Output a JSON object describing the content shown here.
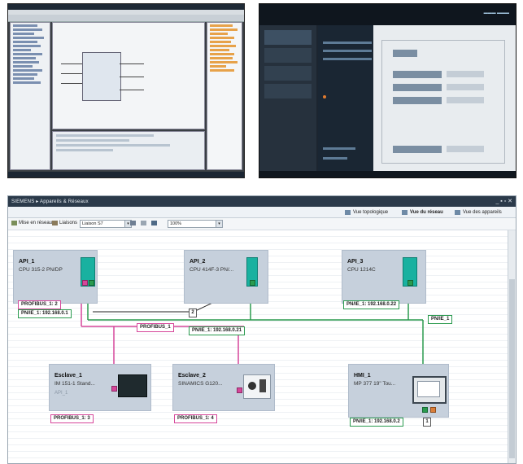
{
  "window": {
    "title": "SIEMENS  ▸  Appareils & Réseaux",
    "controls": "_ ▪ ▫ ✕"
  },
  "view_tabs": [
    {
      "label": "Vue topologique",
      "active": false
    },
    {
      "label": "Vue du réseau",
      "active": true
    },
    {
      "label": "Vue des appareils",
      "active": false
    }
  ],
  "toolbar": {
    "network_button": "Mise en réseau",
    "connections_button": "Liaisons",
    "connection_type": "Liaison S7",
    "zoom": "100%"
  },
  "devices": {
    "plc1": {
      "name": "API_1",
      "type": "CPU 315-2 PN/DP"
    },
    "plc2": {
      "name": "API_2",
      "type": "CPU 414F-3 PN/..."
    },
    "plc3": {
      "name": "API_3",
      "type": "CPU 1214C"
    },
    "slave1": {
      "name": "Esclave_1",
      "type": "IM 151-1 Stand...",
      "sub": "API_1"
    },
    "slave2": {
      "name": "Esclave_2",
      "type": "SINAMICS G120..."
    },
    "hmi1": {
      "name": "HMI_1",
      "type": "MP 377 19\" Tou..."
    }
  },
  "addresses": {
    "plc1_profibus": "PROFIBUS_1: 2",
    "plc1_pn": "PN/IE_1: 192.168.0.1",
    "plc2_pn": "PN/IE_1: 192.168.0.21",
    "plc3_pn": "PN/IE_1: 192.168.0.22",
    "slave1_profibus": "PROFIBUS_1: 3",
    "slave2_profibus": "PROFIBUS_1: 4",
    "hmi_pn": "PN/IE_1: 192.168.0.2"
  },
  "network_labels": {
    "profibus": "PROFIBUS_1",
    "pnie": "PN/IE_1",
    "badge_2": "2",
    "badge_1": "1"
  },
  "colors": {
    "profibus": "#d6469a",
    "profinet": "#2a9a4e",
    "module": "#19b1a0",
    "device_bg": "#c6d0dc"
  }
}
